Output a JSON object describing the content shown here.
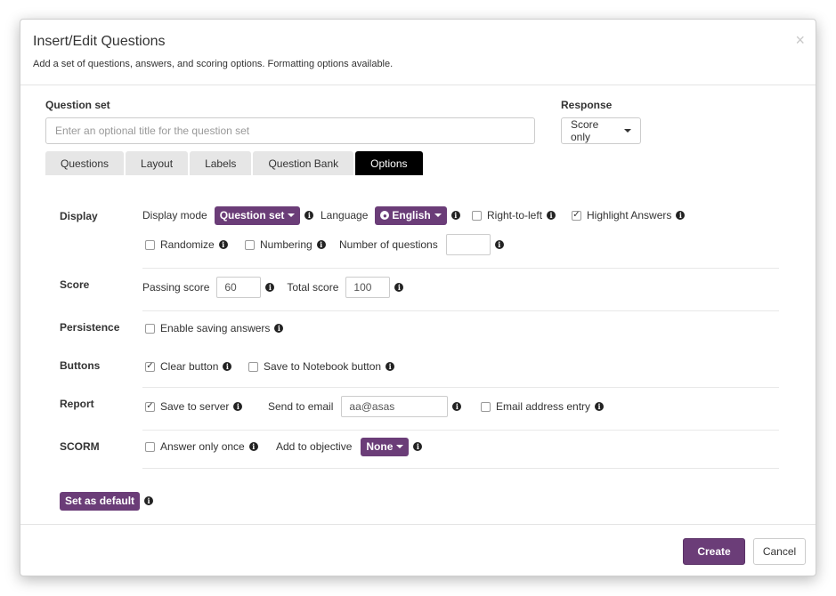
{
  "dialog": {
    "title": "Insert/Edit Questions",
    "subtitle": "Add a set of questions, answers, and scoring options. Formatting options available.",
    "close_glyph": "×"
  },
  "question_set": {
    "label": "Question set",
    "placeholder": "Enter an optional title for the question set",
    "value": ""
  },
  "response": {
    "label": "Response",
    "selected": "Score only"
  },
  "tabs": [
    {
      "label": "Questions",
      "active": false
    },
    {
      "label": "Layout",
      "active": false
    },
    {
      "label": "Labels",
      "active": false
    },
    {
      "label": "Question Bank",
      "active": false
    },
    {
      "label": "Options",
      "active": true
    }
  ],
  "options": {
    "display": {
      "label": "Display",
      "display_mode_label": "Display mode",
      "display_mode_value": "Question set",
      "language_label": "Language",
      "language_value": "English",
      "right_to_left": {
        "label": "Right-to-left",
        "checked": false
      },
      "highlight_answers": {
        "label": "Highlight Answers",
        "checked": true
      },
      "randomize": {
        "label": "Randomize",
        "checked": false
      },
      "numbering": {
        "label": "Numbering",
        "checked": false
      },
      "num_questions_label": "Number of questions",
      "num_questions_value": ""
    },
    "score": {
      "label": "Score",
      "passing_label": "Passing score",
      "passing_value": "60",
      "total_label": "Total score",
      "total_value": "100"
    },
    "persistence": {
      "label": "Persistence",
      "enable_saving": {
        "label": "Enable saving answers",
        "checked": false
      }
    },
    "buttons": {
      "label": "Buttons",
      "clear_button": {
        "label": "Clear button",
        "checked": true
      },
      "save_notebook": {
        "label": "Save to Notebook button",
        "checked": false
      }
    },
    "report": {
      "label": "Report",
      "save_server": {
        "label": "Save to server",
        "checked": true
      },
      "send_email_label": "Send to email",
      "send_email_value": "aa@asas",
      "email_entry": {
        "label": "Email address entry",
        "checked": false
      }
    },
    "scorm": {
      "label": "SCORM",
      "answer_once": {
        "label": "Answer only once",
        "checked": false
      },
      "objective_label": "Add to objective",
      "objective_value": "None"
    },
    "set_default_label": "Set as default"
  },
  "footer": {
    "create_label": "Create",
    "cancel_label": "Cancel"
  },
  "icons": {
    "info": "info-circle-icon",
    "globe": "globe-icon",
    "check": "check-icon"
  },
  "colors": {
    "accent": "#6b3d78",
    "active_tab": "#000000"
  }
}
